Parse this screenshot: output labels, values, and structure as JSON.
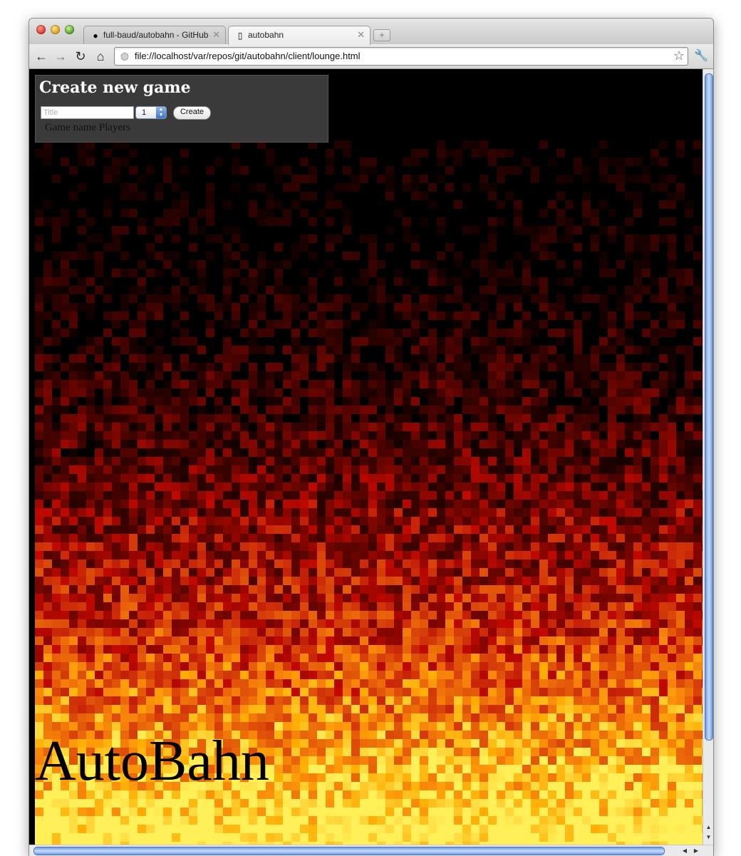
{
  "browser": {
    "tabs": [
      {
        "label": "full-baud/autobahn - GitHub",
        "icon": "github-icon",
        "active": false
      },
      {
        "label": "autobahn",
        "icon": "page-icon",
        "active": true
      }
    ],
    "new_tab_label": "+",
    "url": "file://localhost/var/repos/git/autobahn/client/lounge.html"
  },
  "lounge": {
    "heading": "Create new game",
    "title_placeholder": "Title",
    "players_value": "1",
    "create_label": "Create",
    "games_table_header": "Game name Players"
  },
  "logo_text": "AutoBahn",
  "colors": {
    "panel_bg": "#3a3a3a",
    "page_bg": "#000000",
    "fire_hot": "#ff3a12",
    "fire_glow": "#ffd36b"
  }
}
